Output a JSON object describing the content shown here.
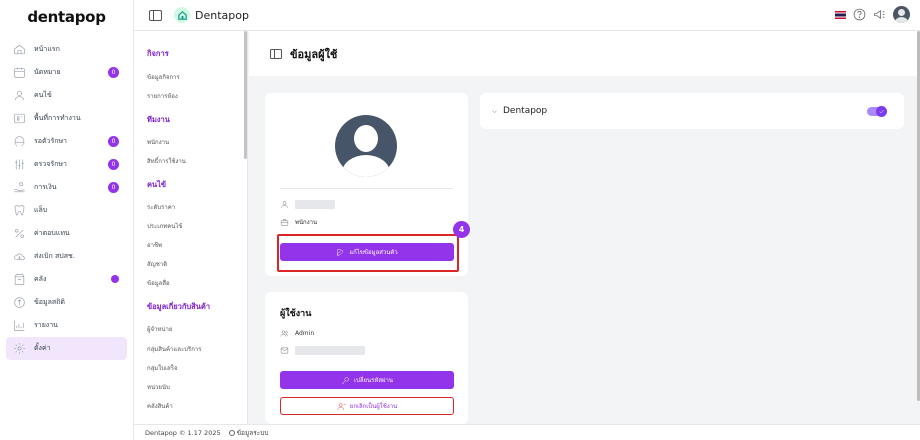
{
  "brand": {
    "logo_main": "denta",
    "logo_accent": "pop"
  },
  "header": {
    "clinic_name": "Dentapop"
  },
  "sidebar": {
    "items": [
      {
        "label": "หน้าแรก",
        "icon": "home-icon",
        "badge": ""
      },
      {
        "label": "นัดหมาย",
        "icon": "calendar-icon",
        "badge": "0"
      },
      {
        "label": "คนไข้",
        "icon": "user-icon",
        "badge": ""
      },
      {
        "label": "พื้นที่การทำงาน",
        "icon": "workspace-icon",
        "badge": ""
      },
      {
        "label": "รอตัวรักษา",
        "icon": "waiting-icon",
        "badge": "0"
      },
      {
        "label": "ตรวจรักษา",
        "icon": "treatment-icon",
        "badge": "0"
      },
      {
        "label": "การเงิน",
        "icon": "finance-icon",
        "badge": "0"
      },
      {
        "label": "แล็บ",
        "icon": "tooth-icon",
        "badge": ""
      },
      {
        "label": "ค่าตอบแทน",
        "icon": "percent-icon",
        "badge": ""
      },
      {
        "label": "ส่งเบิก สปสช.",
        "icon": "cloud-icon",
        "badge": ""
      },
      {
        "label": "คลัง",
        "icon": "inventory-icon",
        "badge": "dot"
      },
      {
        "label": "ข้อมูลสถิติ",
        "icon": "stats-icon",
        "badge": ""
      },
      {
        "label": "รายงาน",
        "icon": "report-icon",
        "badge": ""
      },
      {
        "label": "ตั้งค่า",
        "icon": "gear-icon",
        "badge": ""
      }
    ]
  },
  "submenu": {
    "groups": [
      {
        "title": "กิจการ",
        "items": [
          "ข้อมูลกิจการ",
          "รายการห้อง"
        ]
      },
      {
        "title": "ทีมงาน",
        "items": [
          "พนักงาน",
          "สิทธิ์การใช้งาน"
        ]
      },
      {
        "title": "คนไข้",
        "items": [
          "ระดับราคา",
          "ประเภทคนไข้",
          "อาชีพ",
          "สัญชาติ",
          "ข้อมูลสื่อ"
        ]
      },
      {
        "title": "ข้อมูลเกี่ยวกับสินค้า",
        "items": [
          "ผู้จำหน่าย",
          "กลุ่มสินค้าและบริการ",
          "กลุ่มใบเสร็จ",
          "หน่วยนับ",
          "คลังสินค้า"
        ]
      }
    ]
  },
  "page": {
    "title": "ข้อมูลผู้ใช้"
  },
  "profile": {
    "role": "พนักงาน",
    "edit_button": "แก้ไขข้อมูลส่วนตัว",
    "step_number": "4"
  },
  "user_card": {
    "title": "ผู้ใช้งาน",
    "role": "Admin",
    "change_password_button": "เปลี่ยนรหัสผ่าน",
    "cancel_user_button": "ยกเลิกเป็นผู้ใช้งาน"
  },
  "clinic": {
    "name": "Dentapop",
    "enabled": true
  },
  "footer": {
    "copyright": "Dentapop © 1.17 2025",
    "system_info": "ข้อมูลระบบ"
  },
  "colors": {
    "accent": "#9333ea",
    "highlight": "#dc2626"
  }
}
